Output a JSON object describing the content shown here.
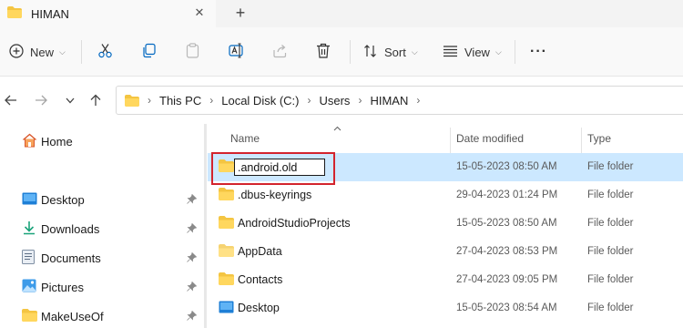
{
  "tab": {
    "title": "HIMAN",
    "close_icon": "close-icon",
    "add_icon": "plus-icon"
  },
  "toolbar": {
    "new_label": "New",
    "sort_label": "Sort",
    "view_label": "View",
    "more_label": "···"
  },
  "address": {
    "crumbs": [
      "This PC",
      "Local Disk (C:)",
      "Users",
      "HIMAN"
    ],
    "trailing_chevron": "›"
  },
  "sidebar": {
    "items": [
      {
        "label": "Home",
        "icon": "home-icon"
      },
      {
        "label": "Desktop",
        "icon": "desktop-icon"
      },
      {
        "label": "Downloads",
        "icon": "download-icon"
      },
      {
        "label": "Documents",
        "icon": "document-icon"
      },
      {
        "label": "Pictures",
        "icon": "pictures-icon"
      },
      {
        "label": "MakeUseOf",
        "icon": "folder-icon"
      }
    ]
  },
  "columns": {
    "name": "Name",
    "date": "Date modified",
    "type": "Type"
  },
  "rows": [
    {
      "name": ".android.old",
      "date": "15-05-2023 08:50 AM",
      "type": "File folder",
      "selected": true,
      "renaming": true
    },
    {
      "name": ".dbus-keyrings",
      "date": "29-04-2023 01:24 PM",
      "type": "File folder"
    },
    {
      "name": "AndroidStudioProjects",
      "date": "15-05-2023 08:50 AM",
      "type": "File folder"
    },
    {
      "name": "AppData",
      "date": "27-04-2023 08:53 PM",
      "type": "File folder"
    },
    {
      "name": "Contacts",
      "date": "27-04-2023 09:05 PM",
      "type": "File folder"
    },
    {
      "name": "Desktop",
      "date": "15-05-2023 08:54 AM",
      "type": "File folder"
    }
  ],
  "colors": {
    "selection": "#cce8ff",
    "highlight": "#d3242d",
    "folder": "#f4c542",
    "accent": "#0067c0"
  }
}
